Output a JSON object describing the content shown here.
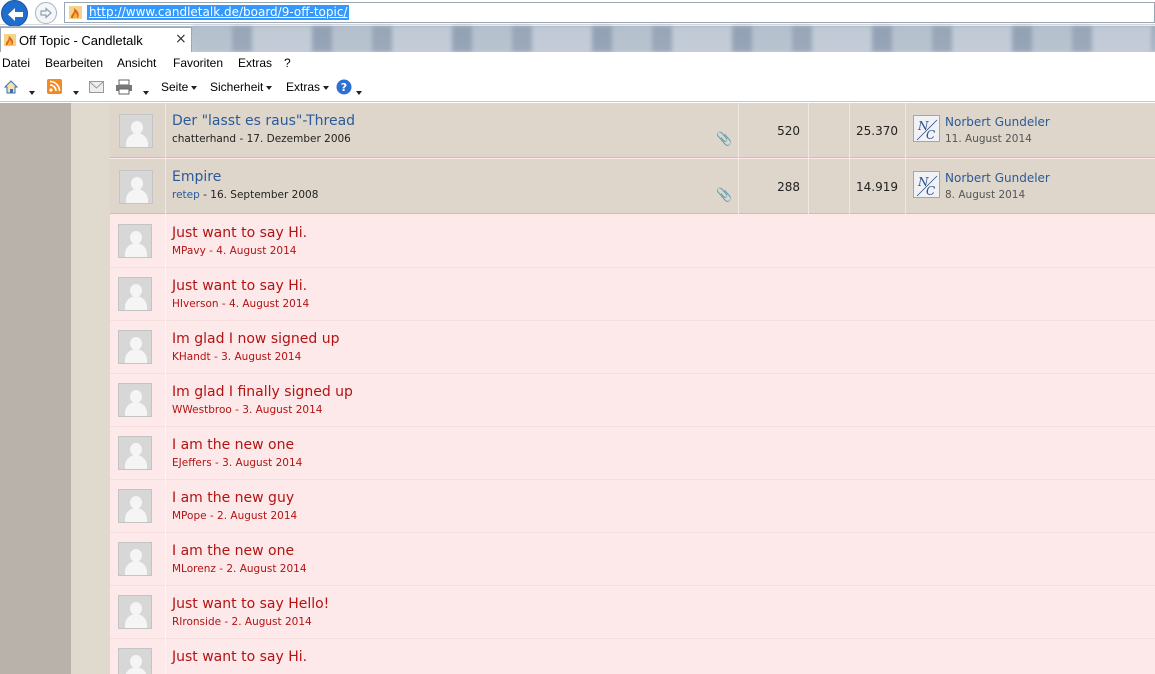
{
  "browser": {
    "address_url": "http://www.candletalk.de/board/9-off-topic/",
    "tab_title": "Off Topic - Candletalk",
    "tab_close": "×",
    "menu": [
      "Datei",
      "Bearbeiten",
      "Ansicht",
      "Favoriten",
      "Extras",
      "?"
    ],
    "commands": {
      "seite": "Seite",
      "sicherheit": "Sicherheit",
      "extras": "Extras"
    }
  },
  "colors": {
    "old_row_bg": "#ded6ca",
    "new_row_bg": "#fde9e9",
    "new_title": "#b31313",
    "link_blue": "#2a5a9a",
    "sidebar": "#b9b2aa"
  },
  "threads_old": [
    {
      "title": "Der \"lasst es raus\"-Thread",
      "author": "chatterhand",
      "sep": " - ",
      "date": "17. Dezember 2006",
      "replies": "520",
      "views": "25.370",
      "last_author": "Norbert Gundeler",
      "last_date": "11. August 2014",
      "icon": "paperclip-icon"
    },
    {
      "title": "Empire",
      "author": "retep",
      "sep": " - ",
      "date": "16. September 2008",
      "replies": "288",
      "views": "14.919",
      "last_author": "Norbert Gundeler",
      "last_date": "8. August 2014",
      "icon": "paperclip-icon"
    }
  ],
  "threads_new": [
    {
      "title": "Just want to say Hi.",
      "author": "MPavy",
      "sep": " - ",
      "date": "4. August 2014"
    },
    {
      "title": "Just want to say Hi.",
      "author": "HIverson",
      "sep": " - ",
      "date": "4. August 2014"
    },
    {
      "title": "Im glad I now signed up",
      "author": "KHandt",
      "sep": " - ",
      "date": "3. August 2014"
    },
    {
      "title": "Im glad I finally signed up",
      "author": "WWestbroo",
      "sep": " - ",
      "date": "3. August 2014"
    },
    {
      "title": "I am the new one",
      "author": "EJeffers",
      "sep": " - ",
      "date": "3. August 2014"
    },
    {
      "title": "I am the new guy",
      "author": "MPope",
      "sep": " - ",
      "date": "2. August 2014"
    },
    {
      "title": "I am the new one",
      "author": "MLorenz",
      "sep": " - ",
      "date": "2. August 2014"
    },
    {
      "title": "Just want to say Hello!",
      "author": "RIronside",
      "sep": " - ",
      "date": "2. August 2014"
    },
    {
      "title": "Just want to say Hi.",
      "author": "",
      "sep": "",
      "date": ""
    }
  ]
}
